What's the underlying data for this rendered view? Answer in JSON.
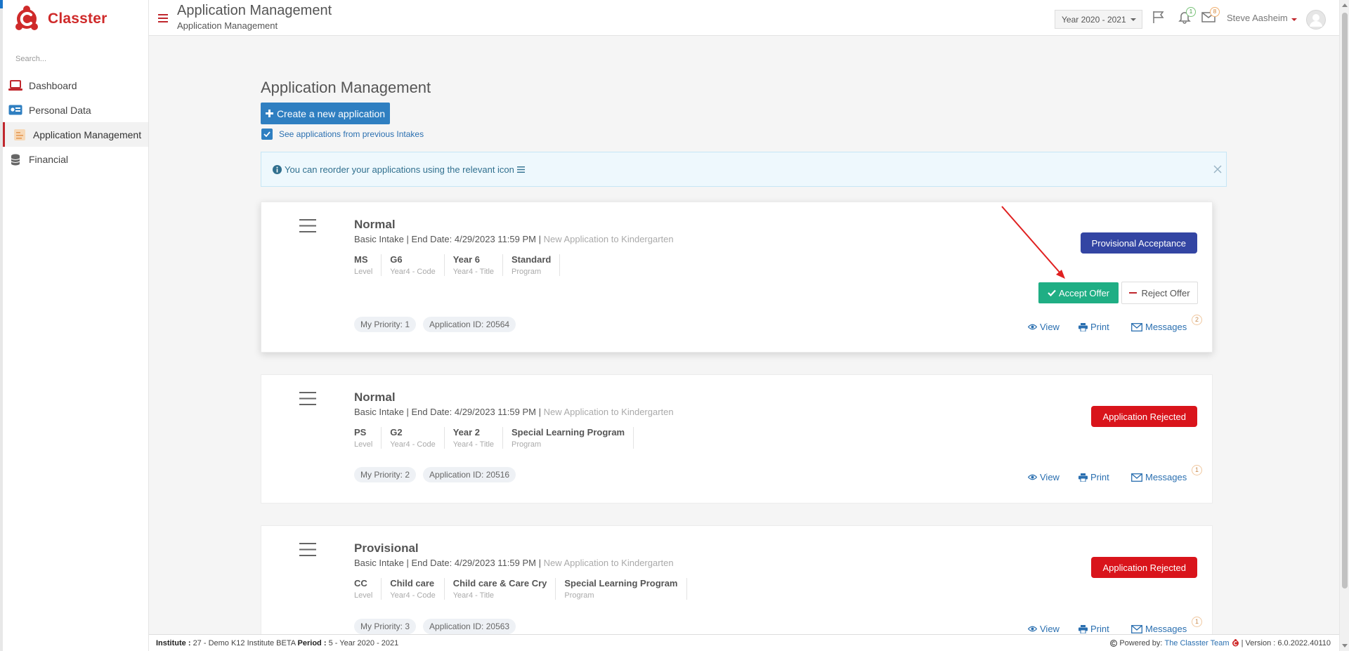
{
  "app": {
    "brand": "Classter",
    "search_placeholder": "Search..."
  },
  "sidebar": {
    "items": [
      {
        "label": "Dashboard",
        "icon": "laptop-icon"
      },
      {
        "label": "Personal Data",
        "icon": "id-card-icon"
      },
      {
        "label": "Application Management",
        "icon": "application-icon",
        "active": true
      },
      {
        "label": "Financial",
        "icon": "coins-icon"
      }
    ]
  },
  "header": {
    "title": "Application Management",
    "subtitle": "Application Management",
    "year": "Year 2020 - 2021",
    "notifications_count": "1",
    "messages_count": "8",
    "user": "Steve Aasheim"
  },
  "main": {
    "title": "Application Management",
    "create_label": "Create a new application",
    "checkbox_label": "See applications from previous Intakes",
    "checkbox_checked": true,
    "info_text": "You can reorder your applications using the relevant icon"
  },
  "applications": [
    {
      "type": "Normal",
      "intake": "Basic Intake",
      "end_date": "End Date: 4/29/2023 11:59 PM",
      "desc": "New Application to Kindergarten",
      "fields": [
        {
          "value": "MS",
          "label": "Level"
        },
        {
          "value": "G6",
          "label": "Year4 - Code"
        },
        {
          "value": "Year 6",
          "label": "Year4 - Title"
        },
        {
          "value": "Standard",
          "label": "Program"
        }
      ],
      "priority": "My Priority: 1",
      "app_id": "Application ID: 20564",
      "status": "Provisional Acceptance",
      "accept_label": "Accept Offer",
      "reject_label": "Reject Offer",
      "messages_count": "2"
    },
    {
      "type": "Normal",
      "intake": "Basic Intake",
      "end_date": "End Date: 4/29/2023 11:59 PM",
      "desc": "New Application to Kindergarten",
      "fields": [
        {
          "value": "PS",
          "label": "Level"
        },
        {
          "value": "G2",
          "label": "Year4 - Code"
        },
        {
          "value": "Year 2",
          "label": "Year4 - Title"
        },
        {
          "value": "Special Learning Program",
          "label": "Program"
        }
      ],
      "priority": "My Priority: 2",
      "app_id": "Application ID: 20516",
      "status": "Application Rejected",
      "messages_count": "1"
    },
    {
      "type": "Provisional",
      "intake": "Basic Intake",
      "end_date": "End Date: 4/29/2023 11:59 PM",
      "desc": "New Application to Kindergarten",
      "fields": [
        {
          "value": "CC",
          "label": "Level"
        },
        {
          "value": "Child care",
          "label": "Year4 - Code"
        },
        {
          "value": "Child care & Care Cry",
          "label": "Year4 - Title"
        },
        {
          "value": "Special Learning Program",
          "label": "Program"
        }
      ],
      "priority": "My Priority: 3",
      "app_id": "Application ID: 20563",
      "status": "Application Rejected",
      "messages_count": "1"
    }
  ],
  "card_actions": {
    "view": "View",
    "print": "Print",
    "messages": "Messages"
  },
  "footer": {
    "institute_label": "Institute :",
    "institute_value": "27 - Demo K12 Institute BETA",
    "period_label": "Period :",
    "period_value": "5 - Year 2020 - 2021",
    "powered_by": "Powered by:",
    "team": "The Classter Team",
    "version": "| Version : 6.0.2022.40110"
  },
  "colors": {
    "brand": "#cf2a2a",
    "primary": "#2f7fc1",
    "accept": "#1fae84",
    "provisional": "#3345a3",
    "rejected": "#d9141b"
  }
}
